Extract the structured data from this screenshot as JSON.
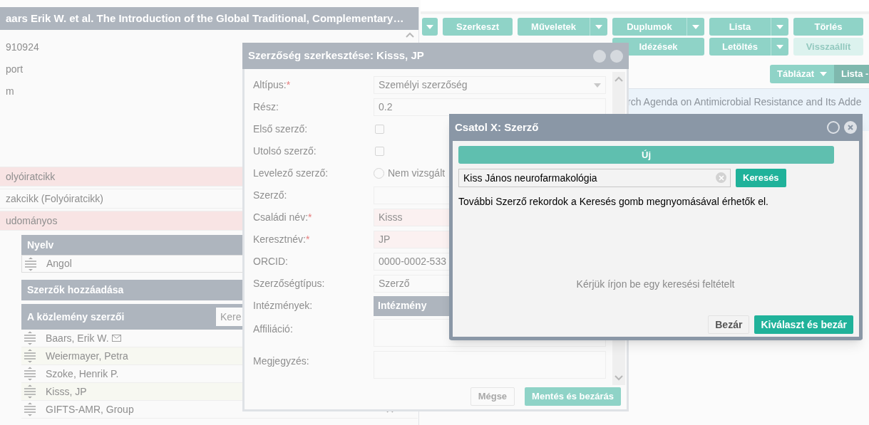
{
  "toolbar": {
    "rows": [
      [
        {
          "caret": true,
          "disabled": false
        },
        {
          "label": "Szerkeszt",
          "caret": false,
          "disabled": false
        },
        {
          "label": "Műveletek",
          "caret": true,
          "disabled": false
        },
        {
          "label": "Duplumok",
          "caret": true,
          "disabled": false
        },
        {
          "label": "Lista",
          "caret": true,
          "disabled": false
        },
        {
          "label": "Törlés",
          "caret": false,
          "disabled": false
        }
      ],
      [
        "",
        "",
        "",
        {
          "label": "Idézések",
          "caret": false,
          "disabled": false
        },
        {
          "label": "Letöltés",
          "caret": true,
          "disabled": false
        },
        {
          "label": "Visszaállít",
          "caret": false,
          "disabled": true
        }
      ]
    ]
  },
  "view_switch": [
    {
      "label": "Táblázat",
      "caret": true,
      "selected": false
    },
    {
      "label": "Lista -",
      "caret": false,
      "selected": true
    }
  ],
  "record_row": {
    "text": "rch Agenda on Antimicrobial Resistance and Its Adde"
  },
  "main_window": {
    "title": "aars Erik W. et al. The Introduction of the Global Traditional, Complementary…",
    "fields": [
      "910924",
      "port",
      "m"
    ],
    "type_rows": [
      {
        "text": "olyóiratcikk",
        "required": true
      },
      {
        "text": "zakcikk (Folyóiratcikk)",
        "required": false
      },
      {
        "text": "udományos",
        "required": true
      }
    ],
    "language_panel": {
      "title": "Nyelv",
      "items": [
        "Angol"
      ]
    },
    "add_authors_panel": {
      "title": "Szerzők hozzáadása"
    },
    "authors_panel": {
      "title": "A közlemény szerzői",
      "search_placeholder": "Kere",
      "authors": [
        {
          "name": "Baars, Erik W.",
          "email": true
        },
        {
          "name": "Weiermayer, Petra",
          "email": false
        },
        {
          "name": "Szoke, Henrik P.",
          "email": false
        },
        {
          "name": "Kisss, JP",
          "email": false
        },
        {
          "name": "GIFTS-AMR, Group",
          "email": false
        }
      ]
    }
  },
  "edit_dialog": {
    "title": "Szerzőség szerkesztése: Kisss, JP",
    "fields": [
      {
        "kind": "select",
        "label": "Altípus:",
        "required_mark": "*",
        "value": "Személyi szerzőség"
      },
      {
        "kind": "text",
        "label": "Rész:",
        "value": "0.2"
      },
      {
        "kind": "checkbox",
        "label": "Első szerző:",
        "checked": false
      },
      {
        "kind": "checkbox",
        "label": "Utolsó szerző:",
        "checked": false
      },
      {
        "kind": "radio",
        "label": "Levelező szerző:",
        "value": "Nem vizsgált",
        "checked": false
      },
      {
        "kind": "text",
        "label": "Szerző:"
      },
      {
        "kind": "text",
        "label": "Családi név:",
        "required_mark": "*",
        "value": "Kisss"
      },
      {
        "kind": "text",
        "label": "Keresztnév:",
        "required_mark": "*",
        "value": "JP"
      },
      {
        "kind": "text",
        "label": "ORCID:",
        "value": "0000-0002-533"
      },
      {
        "kind": "text",
        "label": "Szerzőségtípus:",
        "value": "Szerző"
      },
      {
        "kind": "header",
        "label": "Intézmények:",
        "value": "Intézmény"
      },
      {
        "kind": "textarea",
        "label": "Affiliáció:"
      },
      {
        "kind": "textarea",
        "label": "Megjegyzés:"
      }
    ],
    "buttons": [
      {
        "label": "Mégse",
        "primary": false
      },
      {
        "label": "Mentés és bezárás",
        "primary": true
      }
    ]
  },
  "attach_dialog": {
    "title": "Csatol X: Szerző",
    "new_button": "Új",
    "search": {
      "value": "Kiss János neurofarmakológia"
    },
    "search_button": "Keresés",
    "info": "További Szerző rekordok a Keresés gomb megnyomásával érhetők el.",
    "empty_message": "Kérjük írjon be egy keresési feltételt",
    "buttons": [
      {
        "label": "Bezár",
        "primary": false
      },
      {
        "label": "Kiválaszt és bezár",
        "primary": true
      }
    ]
  }
}
